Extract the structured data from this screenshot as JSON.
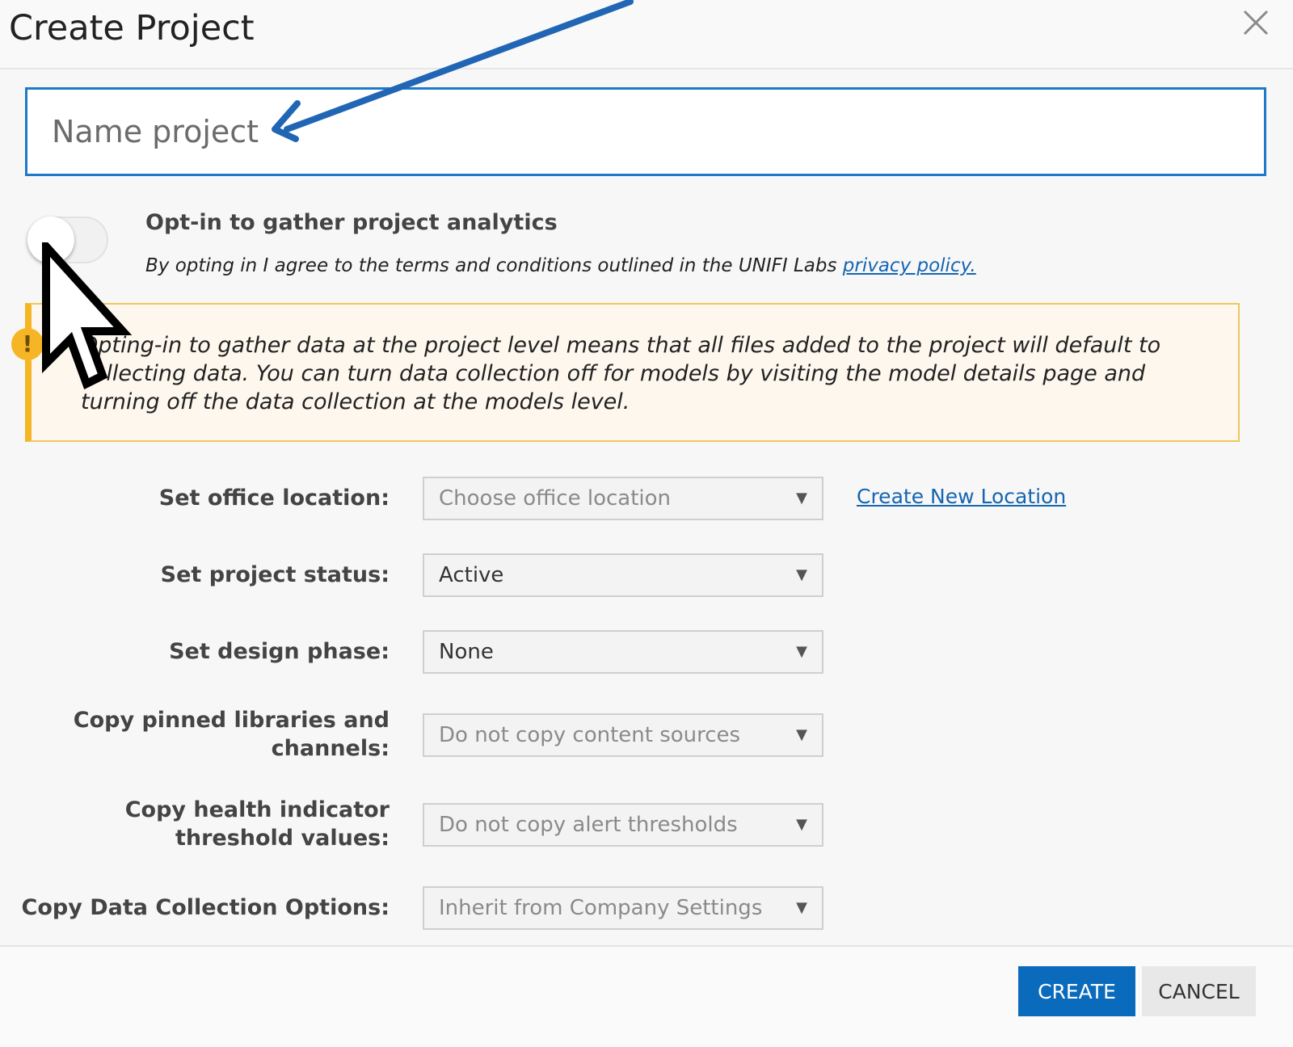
{
  "dialog": {
    "title": "Create Project",
    "close_icon": "close-icon"
  },
  "name_field": {
    "placeholder": "Name project",
    "value": ""
  },
  "analytics": {
    "toggle_on": false,
    "title": "Opt-in to gather project analytics",
    "description": "By opting in I agree to the terms and conditions outlined in the UNIFI Labs ",
    "link_text": "privacy policy."
  },
  "warning": {
    "icon": "warning-icon",
    "icon_glyph": "!",
    "text": "Opting-in to gather data at the project level means that all files added to the project will default to collecting data. You can turn data collection off for models by visiting the model details page and turning off the data collection at the models level."
  },
  "form": {
    "office_location": {
      "label": "Set office location:",
      "value": "Choose office location",
      "is_placeholder": true,
      "link": "Create New Location"
    },
    "project_status": {
      "label": "Set project status:",
      "value": "Active",
      "is_placeholder": false
    },
    "design_phase": {
      "label": "Set design phase:",
      "value": "None",
      "is_placeholder": false
    },
    "pinned_libraries": {
      "label": "Copy pinned libraries and channels:",
      "value": "Do not copy content sources",
      "is_placeholder": true
    },
    "health_threshold": {
      "label": "Copy health indicator threshold values:",
      "value": "Do not copy alert thresholds",
      "is_placeholder": true
    },
    "data_collection": {
      "label": "Copy Data Collection Options:",
      "value": "Inherit from Company Settings",
      "is_placeholder": true
    },
    "dropdown_arrow": "▼"
  },
  "footer": {
    "create_label": "CREATE",
    "cancel_label": "CANCEL"
  },
  "colors": {
    "accent": "#0a6bbd",
    "input_border": "#1e7ac8",
    "link": "#1565b0",
    "warning_border": "#f5b524",
    "warning_bg": "#fdf7ee",
    "annotation_arrow": "#2166b5"
  }
}
